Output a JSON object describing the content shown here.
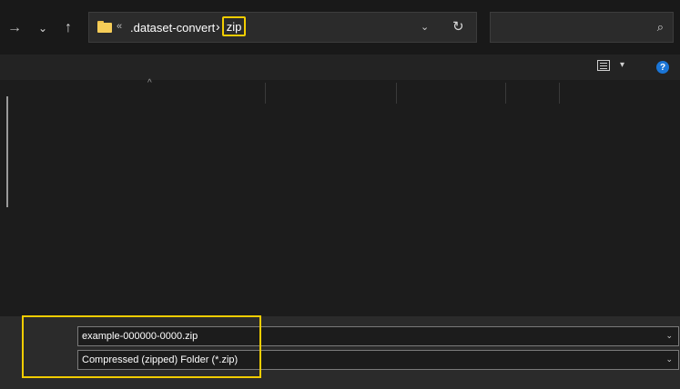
{
  "navigation": {
    "forward_icon": "→",
    "recent_icon": "⌄",
    "up_icon": "↑"
  },
  "address_bar": {
    "folder_icon": "folder-icon",
    "overflow_indicator": "«",
    "breadcrumbs": [
      ".dataset-convert",
      "zip"
    ],
    "separator": "›",
    "dropdown_icon": "⌄",
    "refresh_icon": "↻"
  },
  "search": {
    "value": "",
    "icon": "⌕"
  },
  "command_bar": {
    "view_dropdown_icon": "▾",
    "help_icon": "?"
  },
  "file_list": {
    "sort_indicator": "^"
  },
  "save_panel": {
    "filename": "example-000000-0000.zip",
    "filetype": "Compressed (zipped) Folder (*.zip)",
    "dropdown_icon": "⌄"
  },
  "colors": {
    "highlight": "#f2cd00",
    "accent": "#1a75d6",
    "folder": "#f6cd58"
  }
}
